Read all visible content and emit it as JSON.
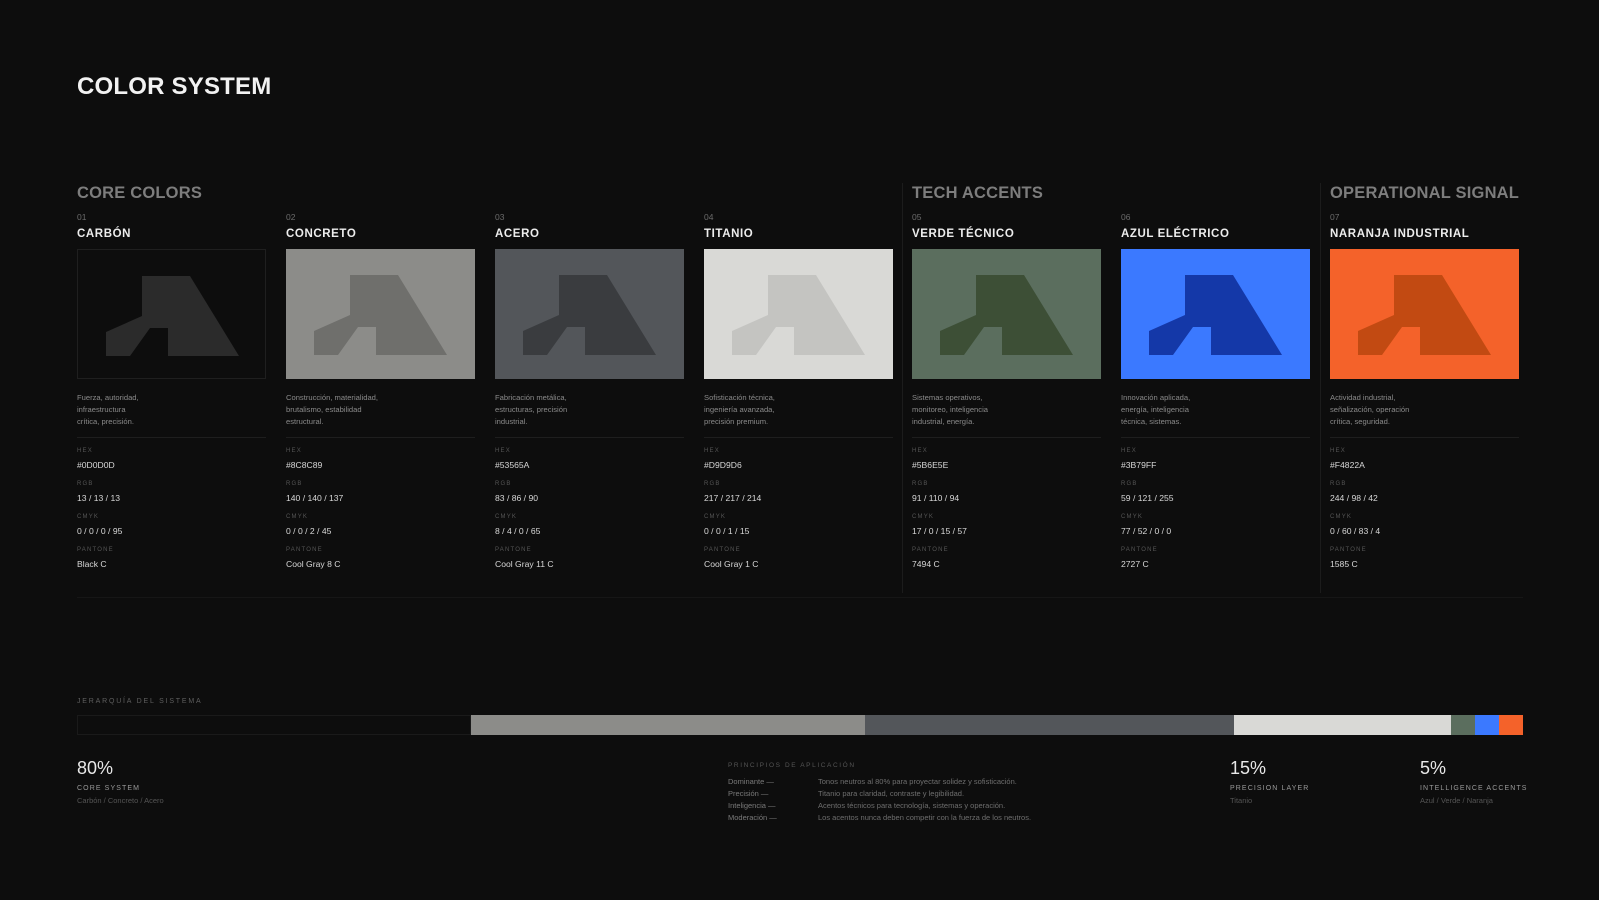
{
  "page": {
    "title": "COLOR SYSTEM",
    "background": "#0D0D0D"
  },
  "groups": [
    {
      "title": "CORE COLORS"
    },
    {
      "title": "TECH ACCENTS"
    },
    {
      "title": "OPERATIONAL SIGNAL"
    }
  ],
  "colors": [
    {
      "num": "01",
      "name": "CARBÓN",
      "swatch": "#0D0D0D",
      "mark": "#2b2b2b",
      "outlined": true,
      "desc": "Fuerza, autoridad,\ninfraestructura\ncrítica, precisión.",
      "hex": "#0D0D0D",
      "rgb": "13 / 13 / 13",
      "cmyk": "0 / 0 / 0 / 95",
      "pantone": "Black C"
    },
    {
      "num": "02",
      "name": "CONCRETO",
      "swatch": "#8C8C89",
      "mark": "#6f6f6c",
      "outlined": false,
      "desc": "Construcción, materialidad,\nbrutalismo, estabilidad\nestructural.",
      "hex": "#8C8C89",
      "rgb": "140 / 140 / 137",
      "cmyk": "0 / 0 / 2 / 45",
      "pantone": "Cool Gray 8 C"
    },
    {
      "num": "03",
      "name": "ACERO",
      "swatch": "#53565A",
      "mark": "#3a3c3f",
      "outlined": false,
      "desc": "Fabricación metálica,\nestructuras, precisión\nindustrial.",
      "hex": "#53565A",
      "rgb": "83 / 86 / 90",
      "cmyk": "8 / 4 / 0 / 65",
      "pantone": "Cool Gray 11 C"
    },
    {
      "num": "04",
      "name": "TITANIO",
      "swatch": "#D9D9D6",
      "mark": "#c4c4c1",
      "outlined": false,
      "desc": "Sofisticación técnica,\ningeniería avanzada,\nprecisión premium.",
      "hex": "#D9D9D6",
      "rgb": "217 / 217 / 214",
      "cmyk": "0 / 0 / 1 / 15",
      "pantone": "Cool Gray 1 C"
    },
    {
      "num": "05",
      "name": "VERDE TÉCNICO",
      "swatch": "#5B6E5E",
      "mark": "#3d4f36",
      "outlined": false,
      "desc": "Sistemas operativos,\nmonitoreo, inteligencia\nindustrial, energía.",
      "hex": "#5B6E5E",
      "rgb": "91 / 110 / 94",
      "cmyk": "17 / 0 / 15 / 57",
      "pantone": "7494 C"
    },
    {
      "num": "06",
      "name": "AZUL ELÉCTRICO",
      "swatch": "#3B79FF",
      "mark": "#1438a8",
      "outlined": false,
      "desc": "Innovación aplicada,\nenergía, inteligencia\ntécnica, sistemas.",
      "hex": "#3B79FF",
      "rgb": "59 / 121 / 255",
      "cmyk": "77 / 52 / 0 / 0",
      "pantone": "2727 C"
    },
    {
      "num": "07",
      "name": "NARANJA INDUSTRIAL",
      "swatch": "#F4622A",
      "mark": "#c24a12",
      "outlined": false,
      "desc": "Actividad industrial,\nseñalización, operación\ncrítica, seguridad.",
      "hex": "#F4822A",
      "rgb": "244 / 98 / 42",
      "cmyk": "0 / 60 / 83 / 4",
      "pantone": "1585 C"
    }
  ],
  "spec_labels": {
    "hex": "HEX",
    "rgb": "RGB",
    "cmyk": "CMYK",
    "pantone": "PANTONE"
  },
  "hierarchy": {
    "label": "JERARQUÍA DEL SISTEMA",
    "bar_segments": [
      {
        "color": "#0D0D0D",
        "fraction": 0.2725
      },
      {
        "color": "#8C8C89",
        "fraction": 0.2725
      },
      {
        "color": "#53565A",
        "fraction": 0.255
      },
      {
        "color": "#D9D9D6",
        "fraction": 0.15
      },
      {
        "color": "#5B6E5E",
        "fraction": 0.0167
      },
      {
        "color": "#3B79FF",
        "fraction": 0.0167
      },
      {
        "color": "#F4622A",
        "fraction": 0.0166
      }
    ],
    "stats": [
      {
        "pct": "80%",
        "label": "CORE SYSTEM",
        "sub": "Carbón / Concreto / Acero"
      },
      {
        "pct": "15%",
        "label": "PRECISION LAYER",
        "sub": "Titanio"
      },
      {
        "pct": "5%",
        "label": "INTELLIGENCE ACCENTS",
        "sub": "Azul / Verde / Naranja"
      }
    ],
    "principles": {
      "title": "PRINCIPIOS DE APLICACIÓN",
      "rows": [
        {
          "key": "Dominante —",
          "value": "Tonos neutros al 80% para proyectar solidez y sofisticación."
        },
        {
          "key": "Precisión —",
          "value": "Titanio para claridad, contraste y legibilidad."
        },
        {
          "key": "Inteligencia —",
          "value": "Acentos técnicos para tecnología, sistemas y operación."
        },
        {
          "key": "Moderación —",
          "value": "Los acentos nunca deben competir con la fuerza de los neutros."
        }
      ]
    }
  }
}
